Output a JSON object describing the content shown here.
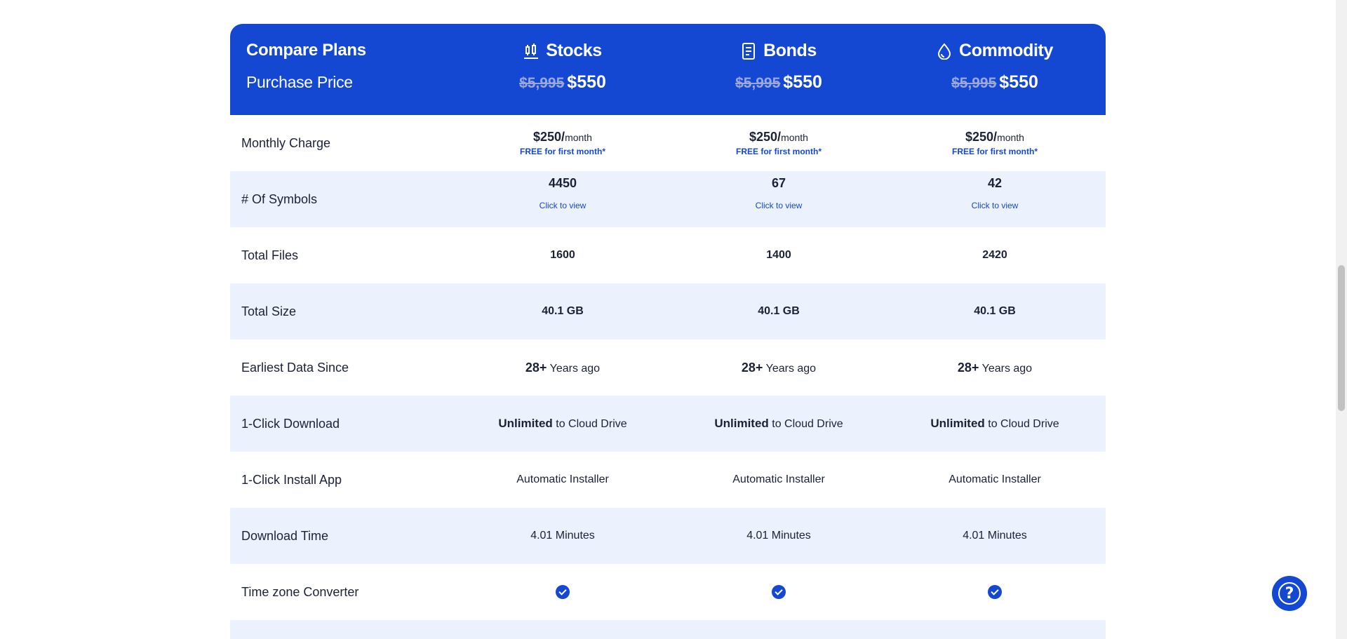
{
  "header": {
    "compare_label": "Compare Plans",
    "price_label": "Purchase Price",
    "plans": [
      {
        "name": "Stocks",
        "icon": "candlestick-chart-icon",
        "old_price": "$5,995",
        "price": "$550"
      },
      {
        "name": "Bonds",
        "icon": "document-icon",
        "old_price": "$5,995",
        "price": "$550"
      },
      {
        "name": "Commodity",
        "icon": "oil-drop-icon",
        "old_price": "$5,995",
        "price": "$550"
      }
    ]
  },
  "rows": {
    "monthly": {
      "label": "Monthly Charge",
      "values": [
        {
          "amount": "$250/",
          "unit": "month",
          "note": "FREE for first month*"
        },
        {
          "amount": "$250/",
          "unit": "month",
          "note": "FREE for first month*"
        },
        {
          "amount": "$250/",
          "unit": "month",
          "note": "FREE for first month*"
        }
      ]
    },
    "symbols": {
      "label": "# Of Symbols",
      "values": [
        {
          "count": "4450",
          "link": "Click to view"
        },
        {
          "count": "67",
          "link": "Click to view"
        },
        {
          "count": "42",
          "link": "Click to view"
        }
      ]
    },
    "files": {
      "label": "Total Files",
      "values": [
        "1600",
        "1400",
        "2420"
      ]
    },
    "size": {
      "label": "Total Size",
      "values": [
        "40.1 GB",
        "40.1 GB",
        "40.1 GB"
      ]
    },
    "earliest": {
      "label": "Earliest Data Since",
      "values": [
        {
          "num": "28+",
          "text": "Years ago"
        },
        {
          "num": "28+",
          "text": "Years ago"
        },
        {
          "num": "28+",
          "text": "Years ago"
        }
      ]
    },
    "download": {
      "label": "1-Click Download",
      "values": [
        {
          "bold": "Unlimited",
          "text": "to Cloud Drive"
        },
        {
          "bold": "Unlimited",
          "text": "to Cloud Drive"
        },
        {
          "bold": "Unlimited",
          "text": "to Cloud Drive"
        }
      ]
    },
    "install": {
      "label": "1-Click Install App",
      "values": [
        "Automatic Installer",
        "Automatic Installer",
        "Automatic Installer"
      ]
    },
    "dltime": {
      "label": "Download Time",
      "values": [
        "4.01 Minutes",
        "4.01 Minutes",
        "4.01 Minutes"
      ]
    },
    "tz": {
      "label": "Time zone Converter",
      "values": [
        "check-icon",
        "check-icon",
        "check-icon"
      ]
    }
  },
  "help": {
    "icon": "question-mark-icon",
    "glyph": "?"
  },
  "colors": {
    "brand": "#1447d2",
    "alt_row": "#ebf1fd",
    "text": "#1b2235"
  }
}
